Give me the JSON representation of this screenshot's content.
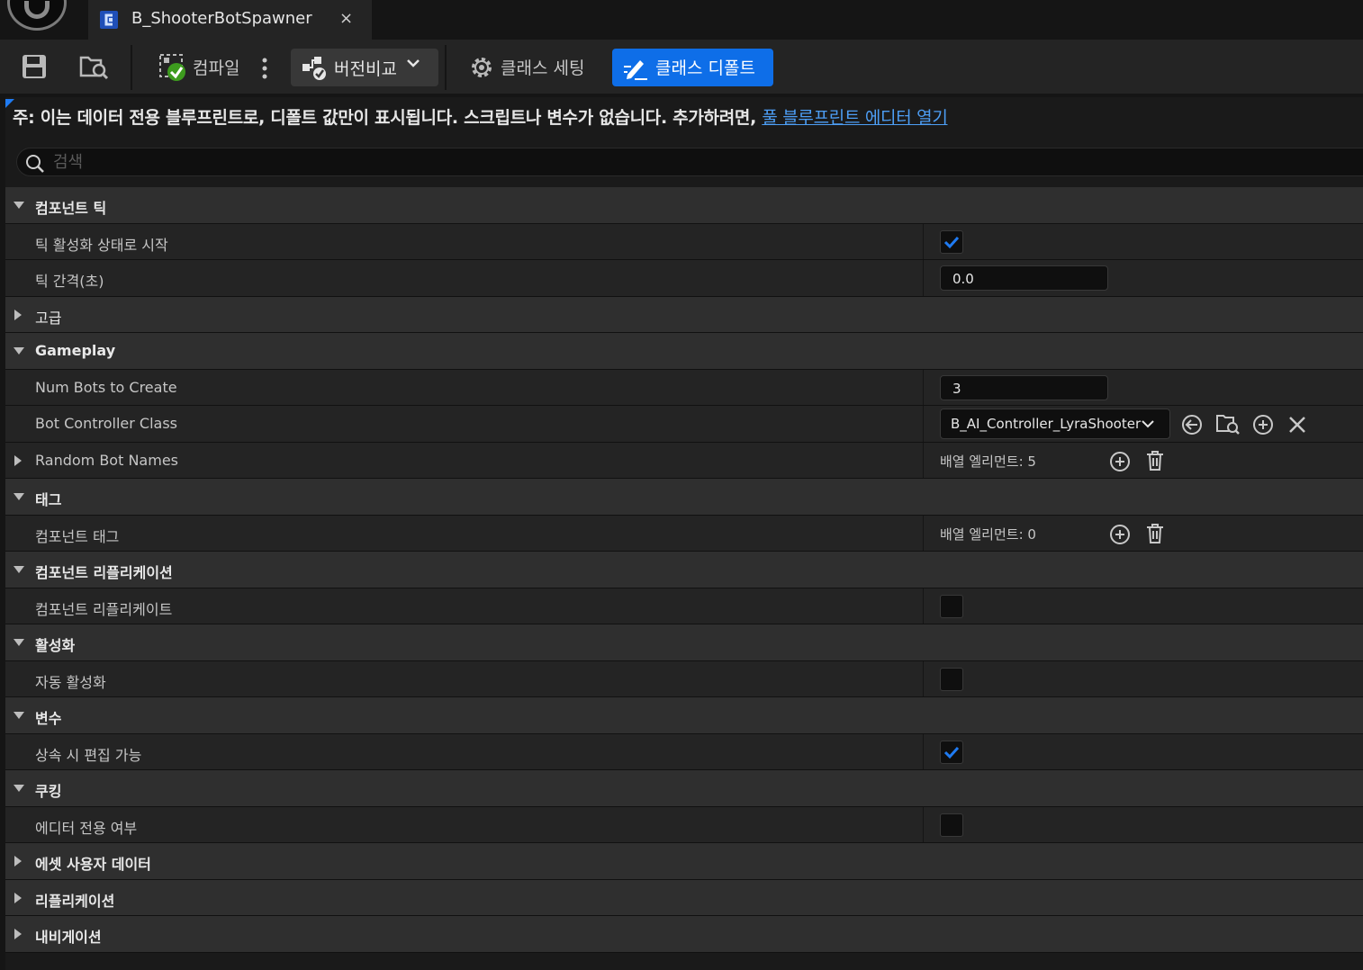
{
  "window": {
    "tab_title": "B_ShooterBotSpawner",
    "tab_close": "×"
  },
  "toolbar": {
    "compile_label": "컴파일",
    "diff_label": "버전비교",
    "class_settings_label": "클래스 세팅",
    "class_defaults_label": "클래스 디폴트",
    "accent": "#0e6ee8"
  },
  "notice": {
    "text": "주: 이는 데이터 전용 블루프린트로, 디폴트 값만이 표시됩니다. 스크립트나 변수가 없습니다. 추가하려면, ",
    "link": "풀 블루프린트 에디터 열기"
  },
  "search": {
    "placeholder": "검색"
  },
  "details": {
    "cat_component_tick": "컴포넌트 틱",
    "start_with_tick_enabled": "틱 활성화 상태로 시작",
    "tick_interval": "틱 간격(초)",
    "tick_interval_value": "0.0",
    "advanced": "고급",
    "cat_gameplay": "Gameplay",
    "num_bots": "Num Bots to Create",
    "num_bots_value": "3",
    "bot_controller_class": "Bot Controller Class",
    "bot_controller_value": "B_AI_Controller_LyraShooter",
    "random_bot_names": "Random Bot Names",
    "random_bot_names_count": "배열 엘리먼트: 5",
    "cat_tags": "태그",
    "component_tags": "컴포넌트 태그",
    "component_tags_count": "배열 엘리먼트: 0",
    "cat_component_replication": "컴포넌트 리플리케이션",
    "component_replicates": "컴포넌트 리플리케이트",
    "cat_activation": "활성화",
    "auto_activate": "자동 활성화",
    "cat_variable": "변수",
    "editable_when_inherited": "상속 시 편집 가능",
    "cat_cooking": "쿠킹",
    "editor_only": "에디터 전용 여부",
    "cat_asset_user_data": "에셋 사용자 데이터",
    "cat_replication": "리플리케이션",
    "cat_navigation": "내비게이션"
  },
  "checkbox_states": {
    "start_with_tick_enabled": true,
    "component_replicates": false,
    "auto_activate": false,
    "editable_when_inherited": true,
    "editor_only": false
  },
  "icons": {
    "save": "save-icon",
    "browse": "browse-folder-icon",
    "compile": "compile-status-icon",
    "more": "more-options-icon",
    "diff": "diff-icon",
    "settings": "gear-icon",
    "defaults": "edit-defaults-icon"
  }
}
